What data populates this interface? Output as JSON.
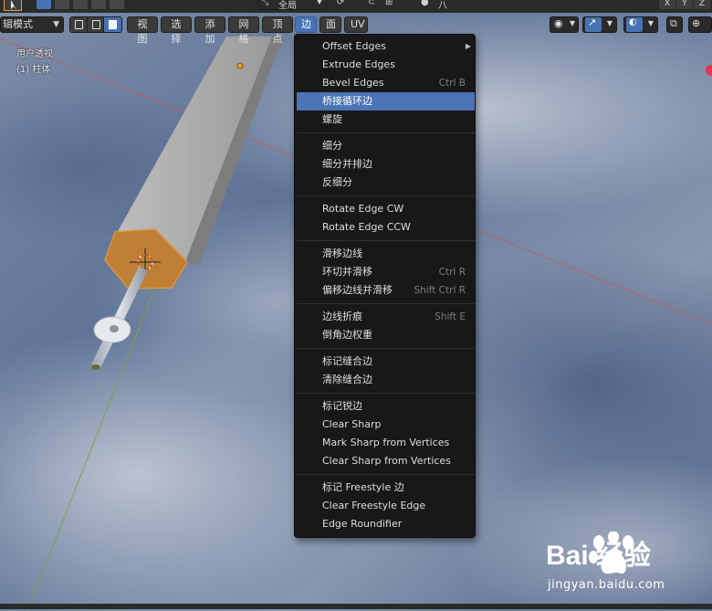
{
  "viewport": {
    "view_label": "用户透视",
    "object_label": "(1) 柱体"
  },
  "topbar": {
    "orientation_value": "全局",
    "axis_x": "X",
    "axis_y": "Y",
    "axis_z": "Z"
  },
  "header": {
    "mode": "辑模式",
    "menus": [
      {
        "label": "视图"
      },
      {
        "label": "选择"
      },
      {
        "label": "添加"
      },
      {
        "label": "网格"
      },
      {
        "label": "顶点"
      },
      {
        "label": "边"
      },
      {
        "label": "面"
      },
      {
        "label": "UV"
      }
    ]
  },
  "edge_menu": {
    "items": [
      {
        "label": "Offset Edges",
        "shortcut": "",
        "submenu": true
      },
      {
        "label": "Extrude Edges",
        "shortcut": ""
      },
      {
        "label": "Bevel Edges",
        "shortcut": "Ctrl B"
      },
      {
        "label": "桥接循环边",
        "shortcut": "",
        "highlighted": true
      },
      {
        "label": "螺旋",
        "shortcut": ""
      },
      {
        "label": "细分",
        "shortcut": ""
      },
      {
        "label": "细分并排边",
        "shortcut": ""
      },
      {
        "label": "反细分",
        "shortcut": ""
      },
      {
        "label": "Rotate Edge CW",
        "shortcut": ""
      },
      {
        "label": "Rotate Edge CCW",
        "shortcut": ""
      },
      {
        "label": "滑移边线",
        "shortcut": ""
      },
      {
        "label": "环切并滑移",
        "shortcut": "Ctrl R"
      },
      {
        "label": "偏移边线并滑移",
        "shortcut": "Shift Ctrl R"
      },
      {
        "label": "边线折痕",
        "shortcut": "Shift E"
      },
      {
        "label": "倒角边权重",
        "shortcut": ""
      },
      {
        "label": "标记缝合边",
        "shortcut": ""
      },
      {
        "label": "清除缝合边",
        "shortcut": ""
      },
      {
        "label": "标记锐边",
        "shortcut": ""
      },
      {
        "label": "Clear Sharp",
        "shortcut": ""
      },
      {
        "label": "Mark Sharp from Vertices",
        "shortcut": ""
      },
      {
        "label": "Clear Sharp from Vertices",
        "shortcut": ""
      },
      {
        "label": "标记 Freestyle 边",
        "shortcut": ""
      },
      {
        "label": "Clear Freestyle Edge",
        "shortcut": ""
      },
      {
        "label": "Edge Roundifier",
        "shortcut": ""
      }
    ]
  },
  "watermark": {
    "brand": "Bai 经验",
    "url": "jingyan.baidu.com"
  }
}
